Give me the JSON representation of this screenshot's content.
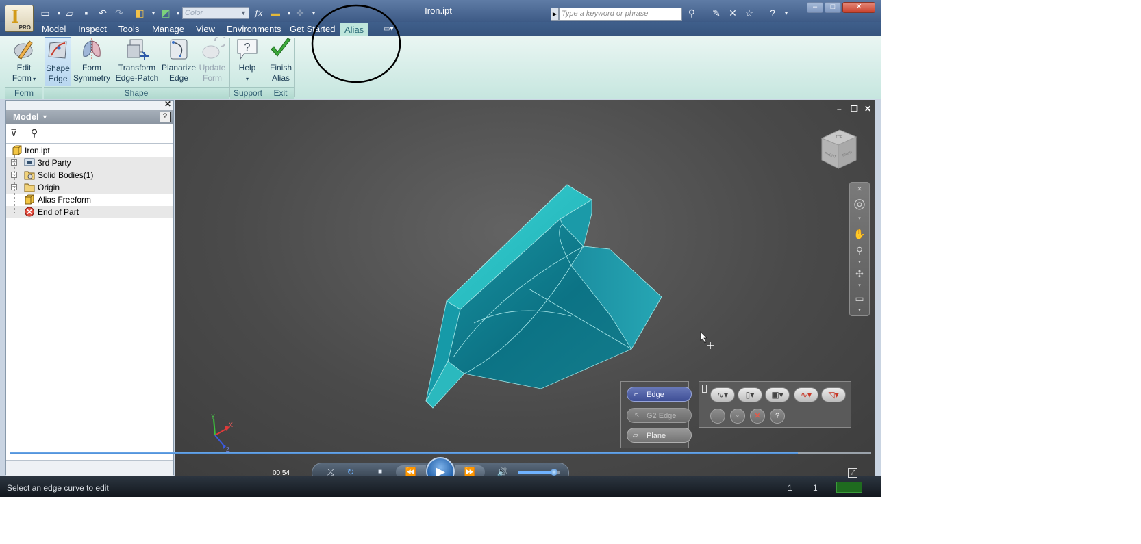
{
  "titlebar": {
    "doc_title": "Iron.ipt",
    "color_placeholder": "Color",
    "search_placeholder": "Type a keyword or phrase",
    "app_badge": "PRO",
    "app_letter": "I",
    "fx_label": "fx"
  },
  "tabs": [
    {
      "label": "Model"
    },
    {
      "label": "Inspect"
    },
    {
      "label": "Tools"
    },
    {
      "label": "Manage"
    },
    {
      "label": "View"
    },
    {
      "label": "Environments"
    },
    {
      "label": "Get Started"
    },
    {
      "label": "Alias",
      "active": true
    }
  ],
  "ribbon": {
    "buttons": [
      {
        "label1": "Edit",
        "label2": "Form"
      },
      {
        "label1": "Shape",
        "label2": "Edge",
        "selected": true
      },
      {
        "label1": "Form",
        "label2": "Symmetry"
      },
      {
        "label1": "Transform",
        "label2": "Edge-Patch"
      },
      {
        "label1": "Planarize",
        "label2": "Edge"
      },
      {
        "label1": "Update",
        "label2": "Form",
        "disabled": true
      },
      {
        "label1": "Help",
        "label2": ""
      },
      {
        "label1": "Finish",
        "label2": "Alias"
      }
    ],
    "panels": [
      "Form",
      "Shape",
      "Support",
      "Exit"
    ]
  },
  "browser": {
    "title": "Model",
    "help_label": "?",
    "tree": [
      {
        "label": "Iron.ipt"
      },
      {
        "label": "3rd Party"
      },
      {
        "label": "Solid Bodies(1)"
      },
      {
        "label": "Origin"
      },
      {
        "label": "Alias Freeform"
      },
      {
        "label": "End of Part"
      }
    ]
  },
  "viewport": {
    "edge_tools": {
      "edge": "Edge",
      "g2_edge": "G2 Edge",
      "plane": "Plane"
    },
    "viewcube_labels": [
      "FRONT",
      "RIGHT",
      "TOP"
    ],
    "axis_labels": [
      "Y",
      "X",
      "Z"
    ]
  },
  "media": {
    "time": "00:54",
    "progress": 0.915,
    "volume": 0.85
  },
  "status": {
    "hint": "Select an edge curve to edit",
    "count1": "1",
    "count2": "1"
  },
  "colors": {
    "ribbon": "#c6e6df",
    "viewport": "#4a4a4a",
    "model_cyan": "#1ea7b4",
    "tab_active": "#bfe6dc"
  }
}
